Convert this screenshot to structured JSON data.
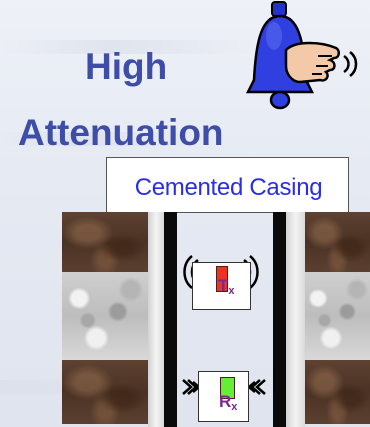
{
  "title": {
    "line1": "High",
    "line2": "Attenuation"
  },
  "casing": {
    "label": "Cemented Casing"
  },
  "transmitter": {
    "letter": "T",
    "subscript": "x",
    "color": "#ee3322"
  },
  "receiver": {
    "letter": "R",
    "subscript": "x",
    "color": "#66ee33"
  },
  "icons": {
    "bell": "bell-icon",
    "hand": "hand-icon"
  },
  "colors": {
    "title": "#3e4ea8",
    "casing_label": "#2a2ee6",
    "tool_label": "#7a2a8a"
  }
}
